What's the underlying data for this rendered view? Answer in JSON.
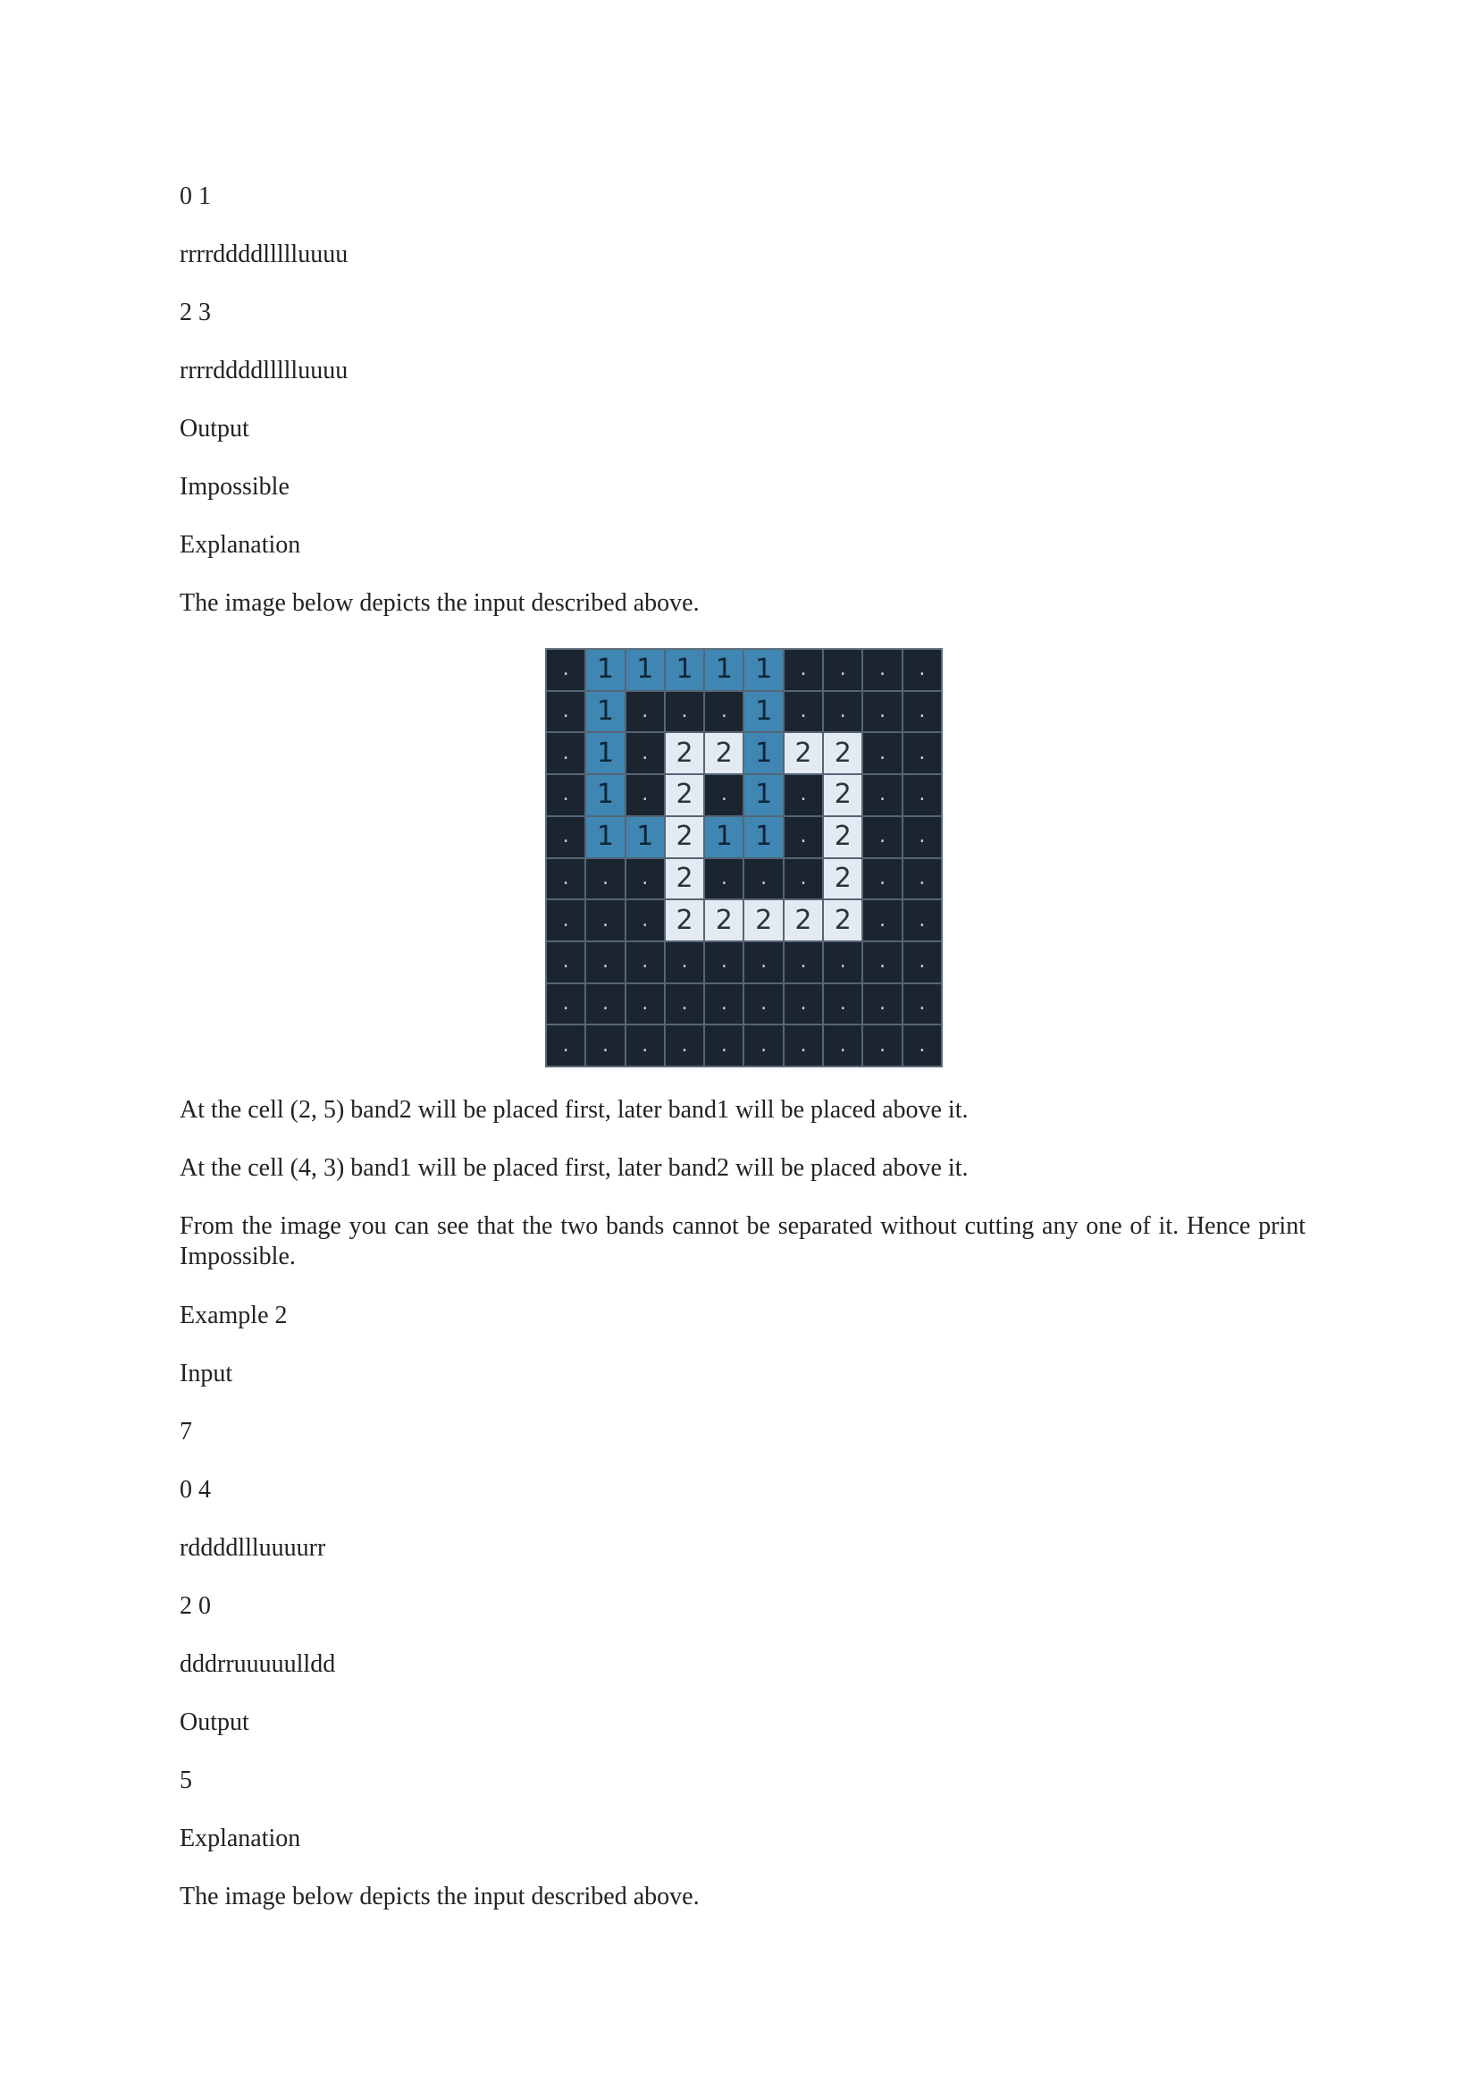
{
  "lines_top": [
    "0 1",
    "rrrrddddllllluuuu",
    "2 3",
    "rrrrddddllllluuuu",
    "Output",
    "Impossible",
    "Explanation",
    "The image below depicts the input described above."
  ],
  "figure1": {
    "colors": {
      "empty": "#1b2530",
      "band1": "#3f86b3",
      "band2": "#e4eaf1"
    },
    "rows": [
      [
        ".",
        "1",
        "1",
        "1",
        "1",
        "1",
        ".",
        ".",
        ".",
        "."
      ],
      [
        ".",
        "1",
        ".",
        ".",
        ".",
        "1",
        ".",
        ".",
        ".",
        "."
      ],
      [
        ".",
        "1",
        ".",
        "2",
        "2",
        "1",
        "2",
        "2",
        ".",
        "."
      ],
      [
        ".",
        "1",
        ".",
        "2",
        ".",
        "1",
        ".",
        "2",
        ".",
        "."
      ],
      [
        ".",
        "1",
        "1",
        "2",
        "1",
        "1",
        ".",
        "2",
        ".",
        "."
      ],
      [
        ".",
        ".",
        ".",
        "2",
        ".",
        ".",
        ".",
        "2",
        ".",
        "."
      ],
      [
        ".",
        ".",
        ".",
        "2",
        "2",
        "2",
        "2",
        "2",
        ".",
        "."
      ],
      [
        ".",
        ".",
        ".",
        ".",
        ".",
        ".",
        ".",
        ".",
        ".",
        "."
      ],
      [
        ".",
        ".",
        ".",
        ".",
        ".",
        ".",
        ".",
        ".",
        ".",
        "."
      ],
      [
        ".",
        ".",
        ".",
        ".",
        ".",
        ".",
        ".",
        ".",
        ".",
        "."
      ]
    ]
  },
  "lines_bottom": [
    "At the cell (2, 5) band2 will be placed first, later band1 will be placed above it.",
    "At the cell (4, 3) band1 will be placed first, later band2 will be placed above it.",
    "From the image you can see that the two bands cannot be separated without cutting any one of it. Hence print Impossible.",
    "Example 2",
    "Input",
    "7",
    "0 4",
    "rddddllluuuurr",
    "2 0",
    "dddrruuuuulldd",
    "Output",
    "5",
    "Explanation",
    "The image below depicts the input described above."
  ]
}
